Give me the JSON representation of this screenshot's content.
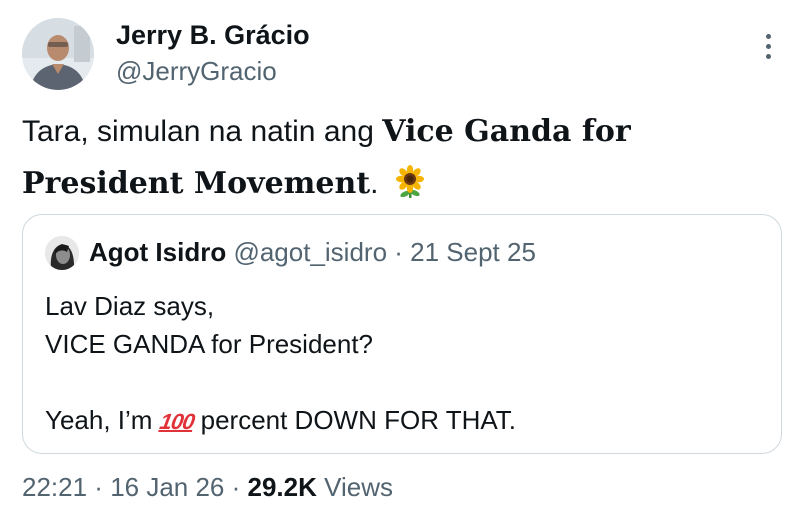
{
  "tweet": {
    "author": {
      "name": "Jerry B. Grácio",
      "handle": "@JerryGracio"
    },
    "text": {
      "part1": "Tara, simulan na natin ang ",
      "bold1": "Vice Ganda for President Movement",
      "part2": ". ",
      "emoji": "sunflower-icon"
    },
    "quoted": {
      "name": "Agot Isidro",
      "handle": "@agot_isidro",
      "separator": " · ",
      "date": "21 Sept 25",
      "lines": [
        "Lav Diaz says,",
        "VICE GANDA for President?",
        "",
        "Yeah, I’m "
      ],
      "emoji_100": "100",
      "line4_end": " percent DOWN FOR THAT."
    },
    "footer": {
      "time": "22:21",
      "sep1": " · ",
      "date": "16 Jan 26",
      "sep2": " · ",
      "views_count": "29.2K",
      "views_label": " Views"
    }
  },
  "colors": {
    "text_primary": "#0f1419",
    "text_secondary": "#536471",
    "border": "#cfd9de",
    "emoji_100": "#e1323a"
  }
}
